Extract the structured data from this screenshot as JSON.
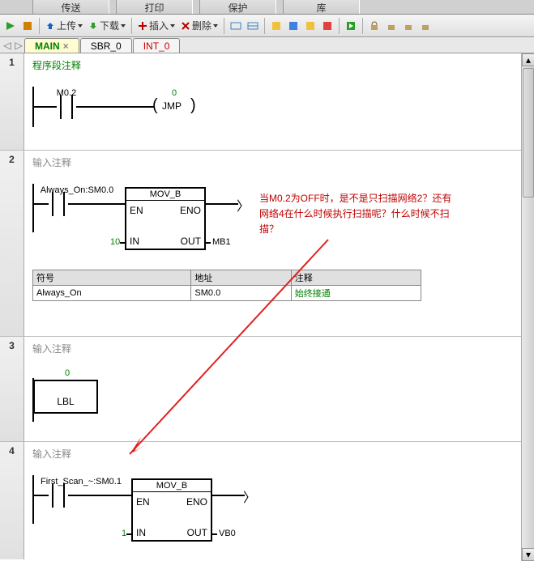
{
  "top_tabs": {
    "t1": "传送",
    "t2": "打印",
    "t3": "保护",
    "t4": "库"
  },
  "toolbar": {
    "upload": "上传",
    "download": "下载",
    "insert": "插入",
    "delete": "删除"
  },
  "doc_tabs": {
    "main": "MAIN",
    "sbr": "SBR_0",
    "int": "INT_0",
    "close": "×"
  },
  "net1": {
    "num": "1",
    "comment": "程序段注释",
    "contact": "M0.2",
    "jmp_n": "0",
    "jmp": "JMP"
  },
  "net2": {
    "num": "2",
    "comment": "输入注释",
    "contact": "Always_On:SM0.0",
    "box_title": "MOV_B",
    "en": "EN",
    "eno": "ENO",
    "in": "IN",
    "out": "OUT",
    "in_val": "10",
    "out_val": "MB1",
    "sym_h1": "符号",
    "sym_h2": "地址",
    "sym_h3": "注释",
    "sym_r1": "Always_On",
    "sym_r2": "SM0.0",
    "sym_r3": "始终接通"
  },
  "net3": {
    "num": "3",
    "comment": "输入注释",
    "lbl_n": "0",
    "lbl": "LBL"
  },
  "net4": {
    "num": "4",
    "comment": "输入注释",
    "contact": "First_Scan_~:SM0.1",
    "box_title": "MOV_B",
    "en": "EN",
    "eno": "ENO",
    "in": "IN",
    "out": "OUT",
    "in_val": "1",
    "out_val": "VB0"
  },
  "annotation": {
    "l1": "当M0.2为OFF时，是不是只扫描网络2？还有",
    "l2": "网络4在什么时候执行扫描呢？什么时候不扫",
    "l3": "描？"
  }
}
